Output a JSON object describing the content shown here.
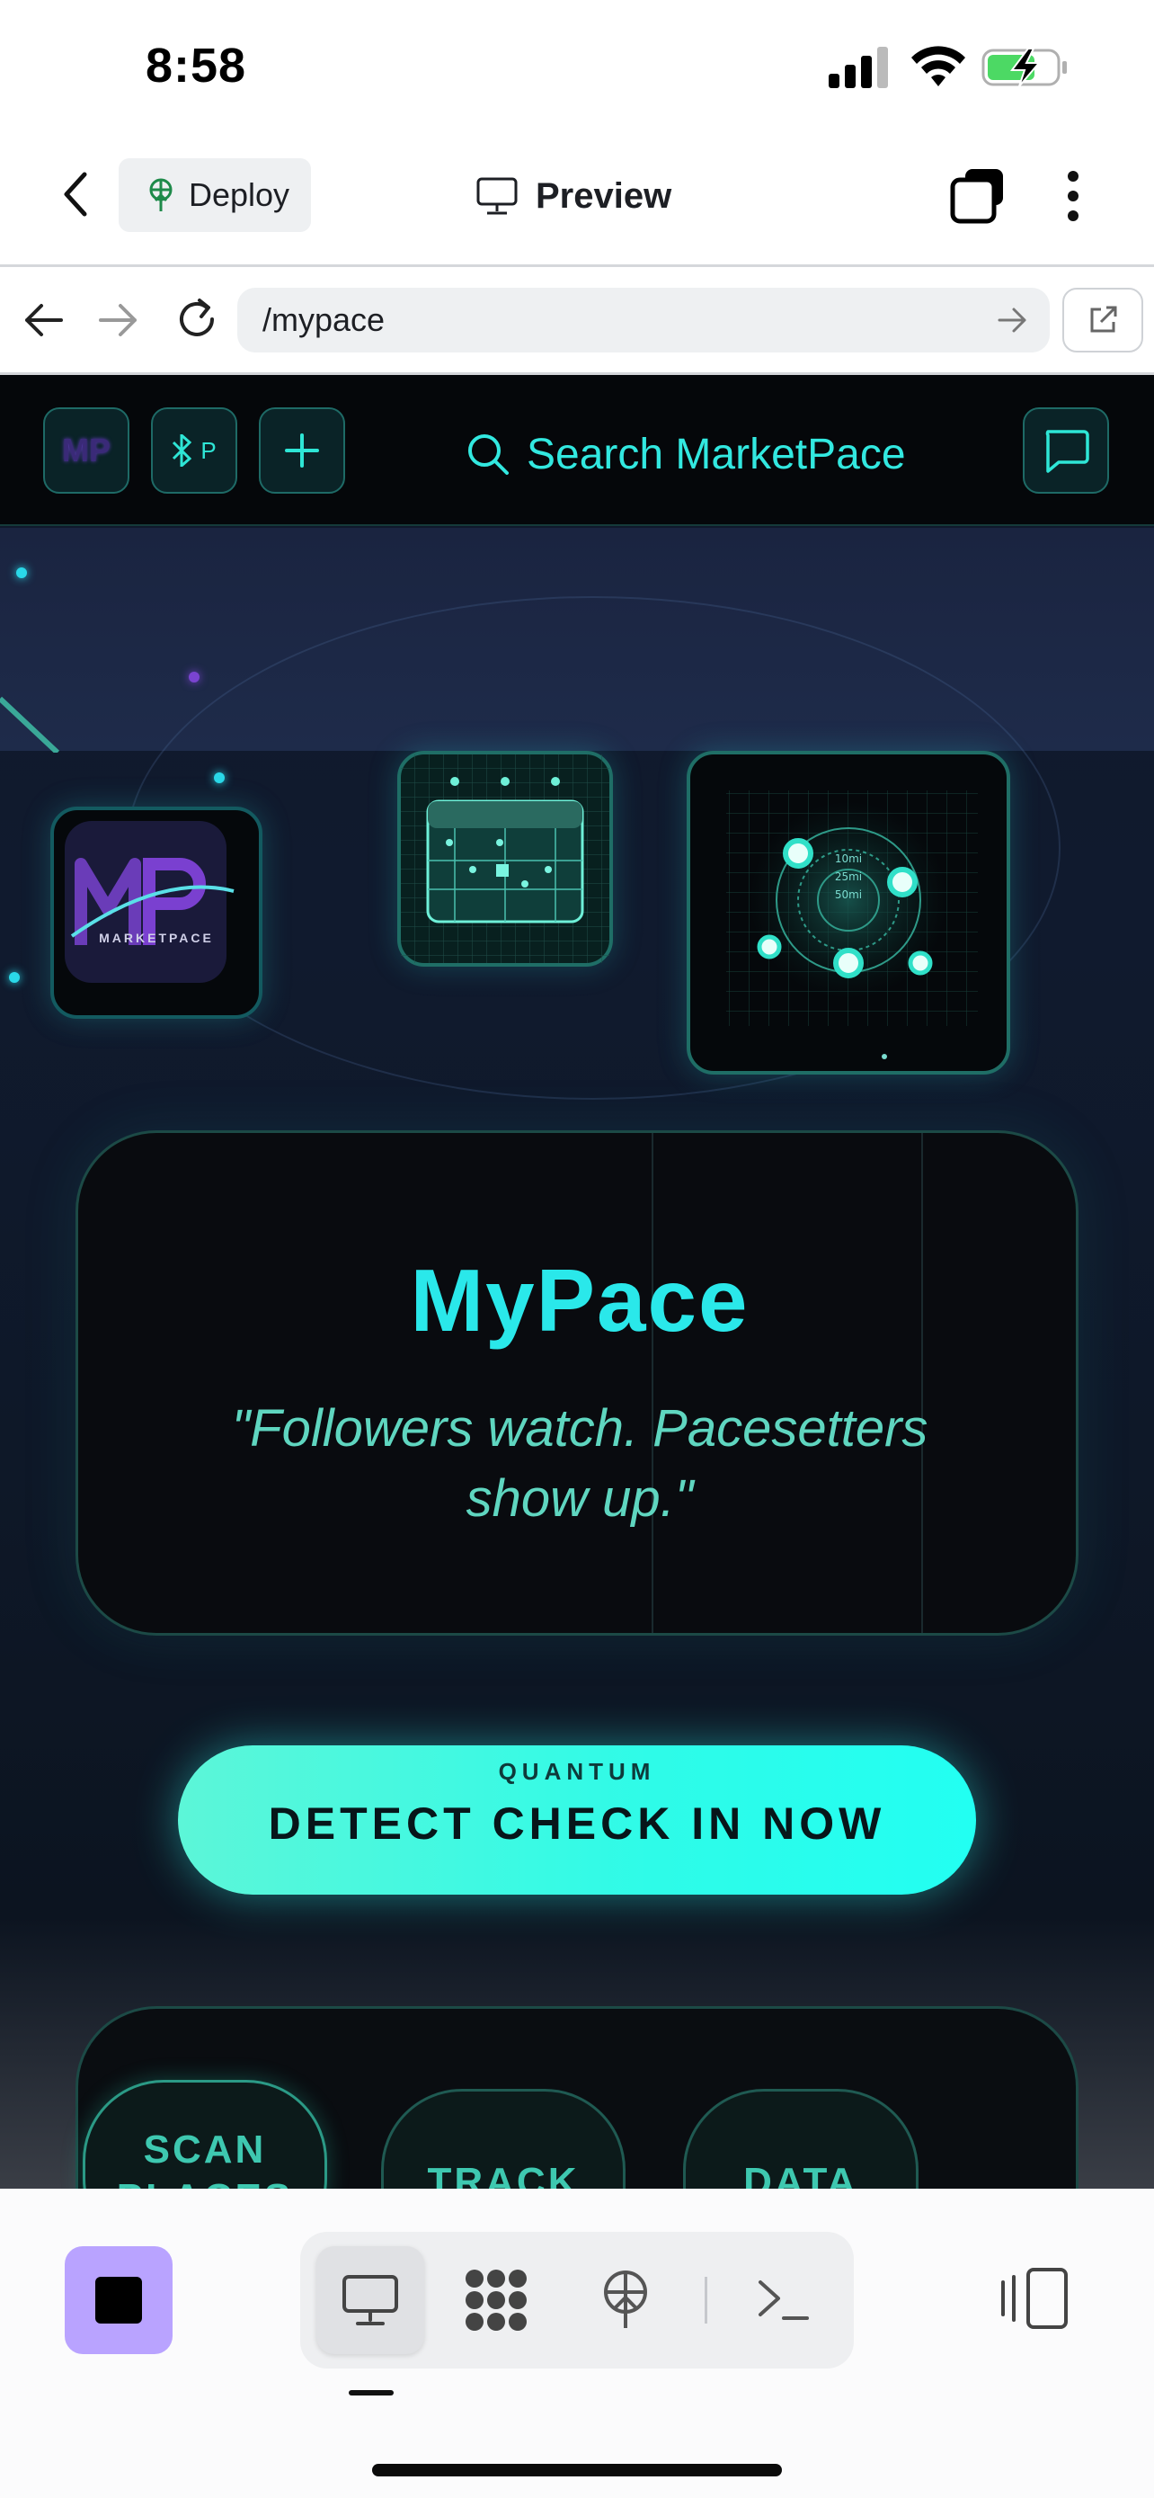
{
  "status_bar": {
    "time": "8:58"
  },
  "top_bar": {
    "deploy_label": "Deploy",
    "title": "Preview"
  },
  "url_bar": {
    "url": "/mypace"
  },
  "app": {
    "header": {
      "logo_initials": "MP",
      "bt_label": "P",
      "search_placeholder": "Search MarketPace"
    },
    "logo_card": {
      "name": "MARKETPACE"
    },
    "radar_labels": [
      "10mi",
      "25mi",
      "50mi"
    ],
    "hero": {
      "title": "MyPace",
      "tagline": "\"Followers watch. Pacesetters show up.\""
    },
    "cta": {
      "tag": "QUANTUM",
      "label": "DETECT CHECK IN NOW"
    },
    "pills": [
      {
        "label": "SCAN PLACES"
      },
      {
        "label": "TRACK"
      },
      {
        "label": "DATA"
      }
    ]
  },
  "colors": {
    "accent": "#2ae8ea",
    "stop_button": "#b9a3ff",
    "app_bg": "#10182a"
  },
  "icons": {
    "top_bar": [
      "chevron-left-icon",
      "deploy-icon",
      "monitor-icon",
      "tabs-icon",
      "kebab-icon"
    ],
    "url_bar": [
      "arrow-left-icon",
      "arrow-right-icon",
      "reload-icon",
      "arrow-right-icon",
      "external-link-icon"
    ],
    "app_header": [
      "bluetooth-icon",
      "plus-icon",
      "search-icon",
      "chat-icon"
    ],
    "bottom_tools": [
      "stop-icon",
      "monitor-icon",
      "workspace-icon",
      "deploy-icon",
      "terminal-icon",
      "layout-icon"
    ]
  }
}
